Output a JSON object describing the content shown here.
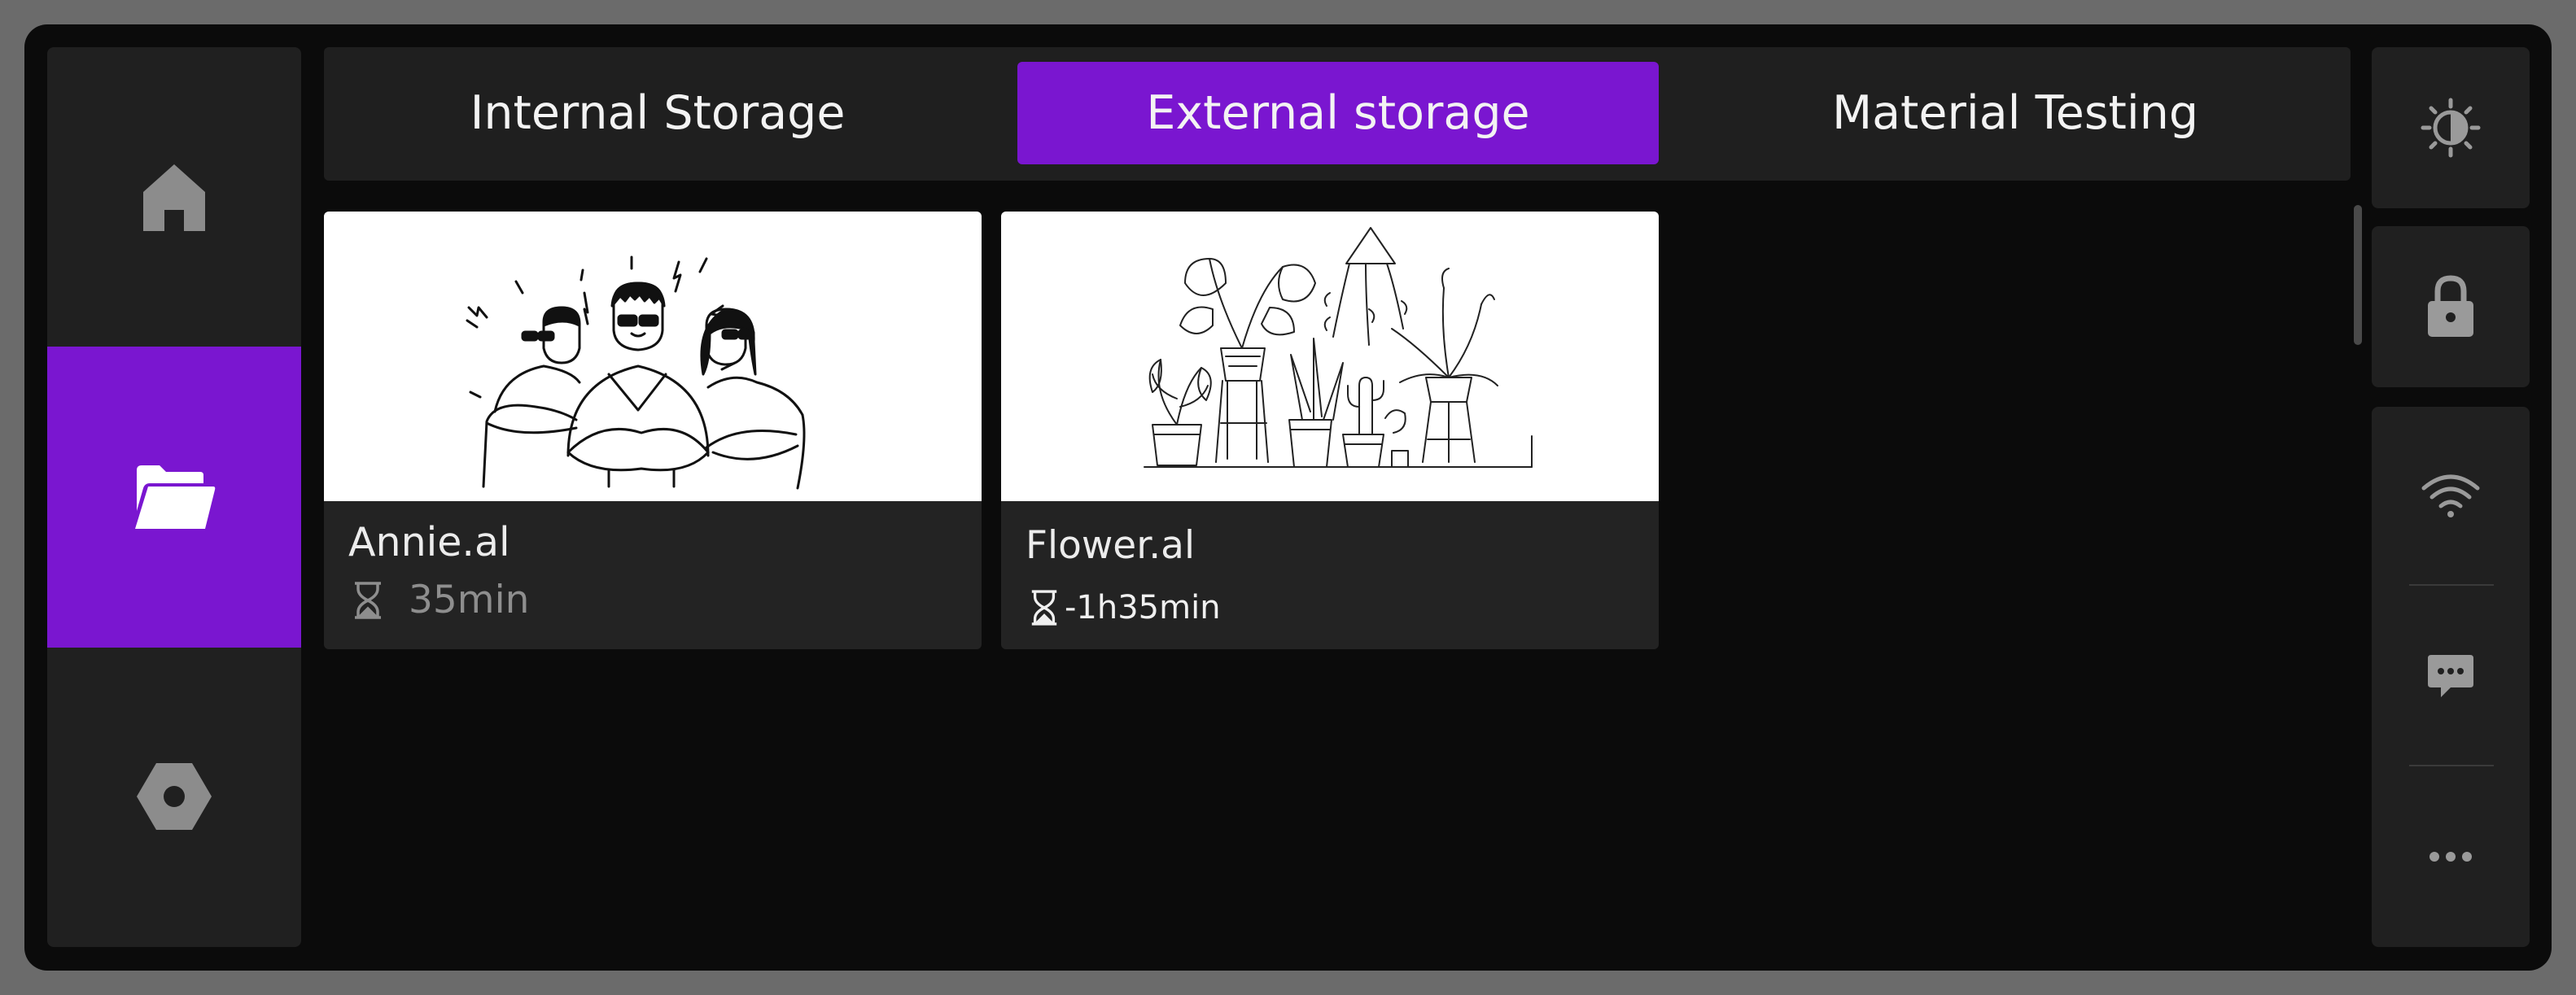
{
  "nav": {
    "items": [
      {
        "name": "home",
        "icon": "home-icon"
      },
      {
        "name": "files",
        "icon": "folder-open-icon",
        "active": true
      },
      {
        "name": "settings",
        "icon": "hex-nut-icon"
      }
    ]
  },
  "tabs": [
    {
      "label": "Internal Storage"
    },
    {
      "label": "External storage",
      "active": true
    },
    {
      "label": "Material Testing"
    }
  ],
  "files": [
    {
      "name": "Annie.al",
      "time": "35min",
      "thumbnail": "three-people-sunglasses-illustration"
    },
    {
      "name": "Flower.al",
      "time": "-1h35min",
      "thumbnail": "potted-plants-illustration"
    }
  ],
  "right_panel": {
    "icons": [
      "brightness-icon",
      "lock-icon",
      "wifi-icon",
      "message-icon",
      "more-icon"
    ]
  },
  "colors": {
    "accent": "#7a16d0",
    "panel": "#202020",
    "background": "#0b0b0b",
    "bezel": "#6b6b6b"
  }
}
